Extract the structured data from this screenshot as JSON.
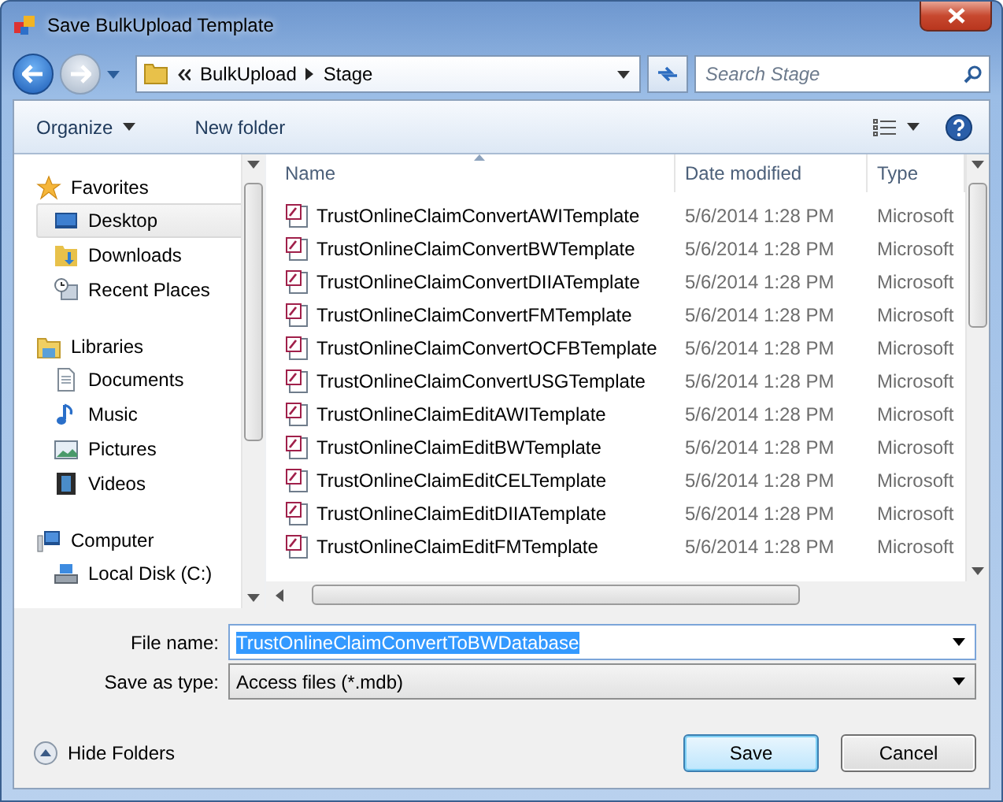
{
  "window": {
    "title": "Save BulkUpload Template"
  },
  "address": {
    "path": [
      "BulkUpload",
      "Stage"
    ]
  },
  "search": {
    "placeholder": "Search Stage"
  },
  "toolbar": [
    {
      "label": "Organize",
      "dropdown": true
    },
    {
      "label": "New folder",
      "dropdown": false
    }
  ],
  "sidebar": [
    {
      "label": "Favorites",
      "kind": "star",
      "items": [
        {
          "label": "Desktop",
          "kind": "desktop",
          "selected": true
        },
        {
          "label": "Downloads",
          "kind": "downloads",
          "selected": false
        },
        {
          "label": "Recent Places",
          "kind": "recent",
          "selected": false
        }
      ]
    },
    {
      "label": "Libraries",
      "kind": "libraries",
      "items": [
        {
          "label": "Documents",
          "kind": "documents",
          "selected": false
        },
        {
          "label": "Music",
          "kind": "music",
          "selected": false
        },
        {
          "label": "Pictures",
          "kind": "pictures",
          "selected": false
        },
        {
          "label": "Videos",
          "kind": "videos",
          "selected": false
        }
      ]
    },
    {
      "label": "Computer",
      "kind": "computer",
      "items": [
        {
          "label": "Local Disk (C:)",
          "kind": "disk",
          "selected": false
        }
      ]
    }
  ],
  "columns": [
    {
      "label": "Name",
      "sorted": true
    },
    {
      "label": "Date modified",
      "sorted": false
    },
    {
      "label": "Type",
      "sorted": false
    }
  ],
  "rows": [
    {
      "name": "TrustOnlineClaimConvertAWITemplate",
      "date": "5/6/2014 1:28 PM",
      "type": "Microsoft"
    },
    {
      "name": "TrustOnlineClaimConvertBWTemplate",
      "date": "5/6/2014 1:28 PM",
      "type": "Microsoft"
    },
    {
      "name": "TrustOnlineClaimConvertDIIATemplate",
      "date": "5/6/2014 1:28 PM",
      "type": "Microsoft"
    },
    {
      "name": "TrustOnlineClaimConvertFMTemplate",
      "date": "5/6/2014 1:28 PM",
      "type": "Microsoft"
    },
    {
      "name": "TrustOnlineClaimConvertOCFBTemplate",
      "date": "5/6/2014 1:28 PM",
      "type": "Microsoft"
    },
    {
      "name": "TrustOnlineClaimConvertUSGTemplate",
      "date": "5/6/2014 1:28 PM",
      "type": "Microsoft"
    },
    {
      "name": "TrustOnlineClaimEditAWITemplate",
      "date": "5/6/2014 1:28 PM",
      "type": "Microsoft"
    },
    {
      "name": "TrustOnlineClaimEditBWTemplate",
      "date": "5/6/2014 1:28 PM",
      "type": "Microsoft"
    },
    {
      "name": "TrustOnlineClaimEditCELTemplate",
      "date": "5/6/2014 1:28 PM",
      "type": "Microsoft"
    },
    {
      "name": "TrustOnlineClaimEditDIIATemplate",
      "date": "5/6/2014 1:28 PM",
      "type": "Microsoft"
    },
    {
      "name": "TrustOnlineClaimEditFMTemplate",
      "date": "5/6/2014 1:28 PM",
      "type": "Microsoft"
    }
  ],
  "file_name": {
    "label": "File name:",
    "value": "TrustOnlineClaimConvertToBWDatabase",
    "text_selected": true
  },
  "save_type": {
    "label": "Save as type:",
    "value": "Access files (*.mdb)"
  },
  "hide_folders": {
    "label": "Hide Folders"
  },
  "buttons": [
    {
      "label": "Save",
      "default": true
    },
    {
      "label": "Cancel",
      "default": false
    }
  ]
}
